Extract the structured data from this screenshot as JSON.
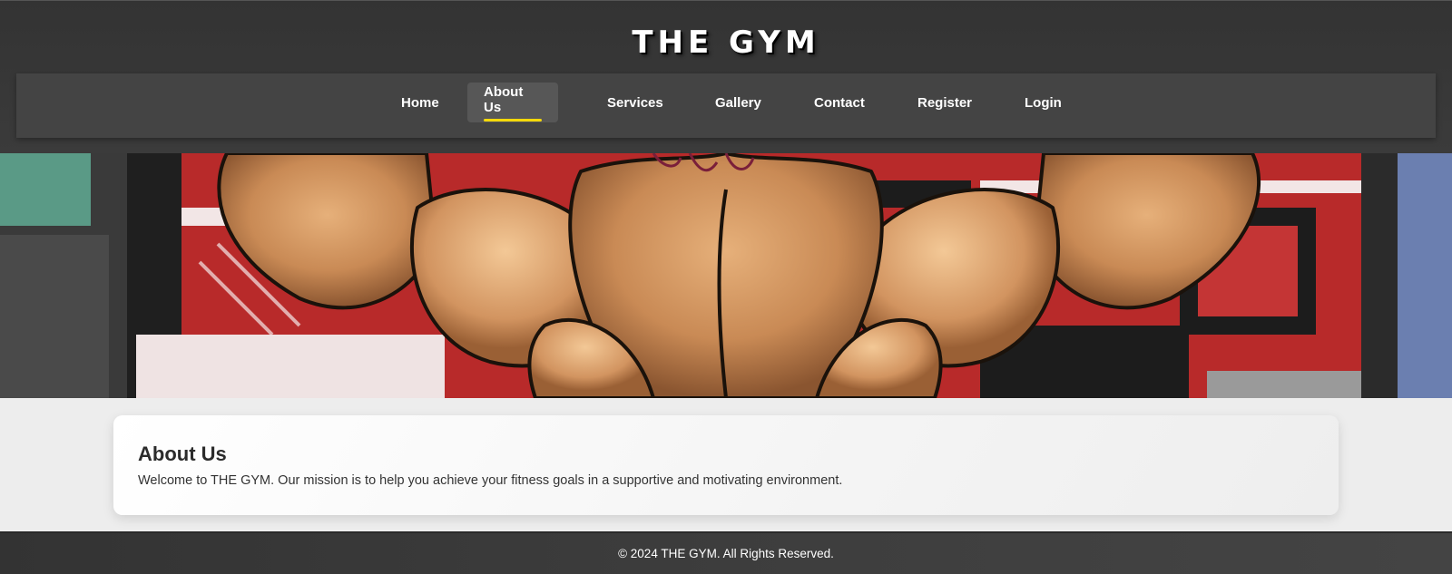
{
  "header": {
    "title": "THE GYM"
  },
  "nav": {
    "items": [
      {
        "label": "Home",
        "active": false
      },
      {
        "label": "About Us",
        "active": true
      },
      {
        "label": "Services",
        "active": false
      },
      {
        "label": "Gallery",
        "active": false
      },
      {
        "label": "Contact",
        "active": false
      },
      {
        "label": "Register",
        "active": false
      },
      {
        "label": "Login",
        "active": false
      }
    ],
    "active_underline_color": "#f5d90a"
  },
  "hero": {
    "image": "muscular-back-illustration"
  },
  "about": {
    "heading": "About Us",
    "text": "Welcome to THE GYM. Our mission is to help you achieve your fitness goals in a supportive and motivating environment."
  },
  "footer": {
    "text": "© 2024 THE GYM. All Rights Reserved."
  },
  "colors": {
    "header_bg": "#333333",
    "nav_bg": "#444444",
    "page_bg": "#ededed",
    "accent": "#f5d90a"
  }
}
